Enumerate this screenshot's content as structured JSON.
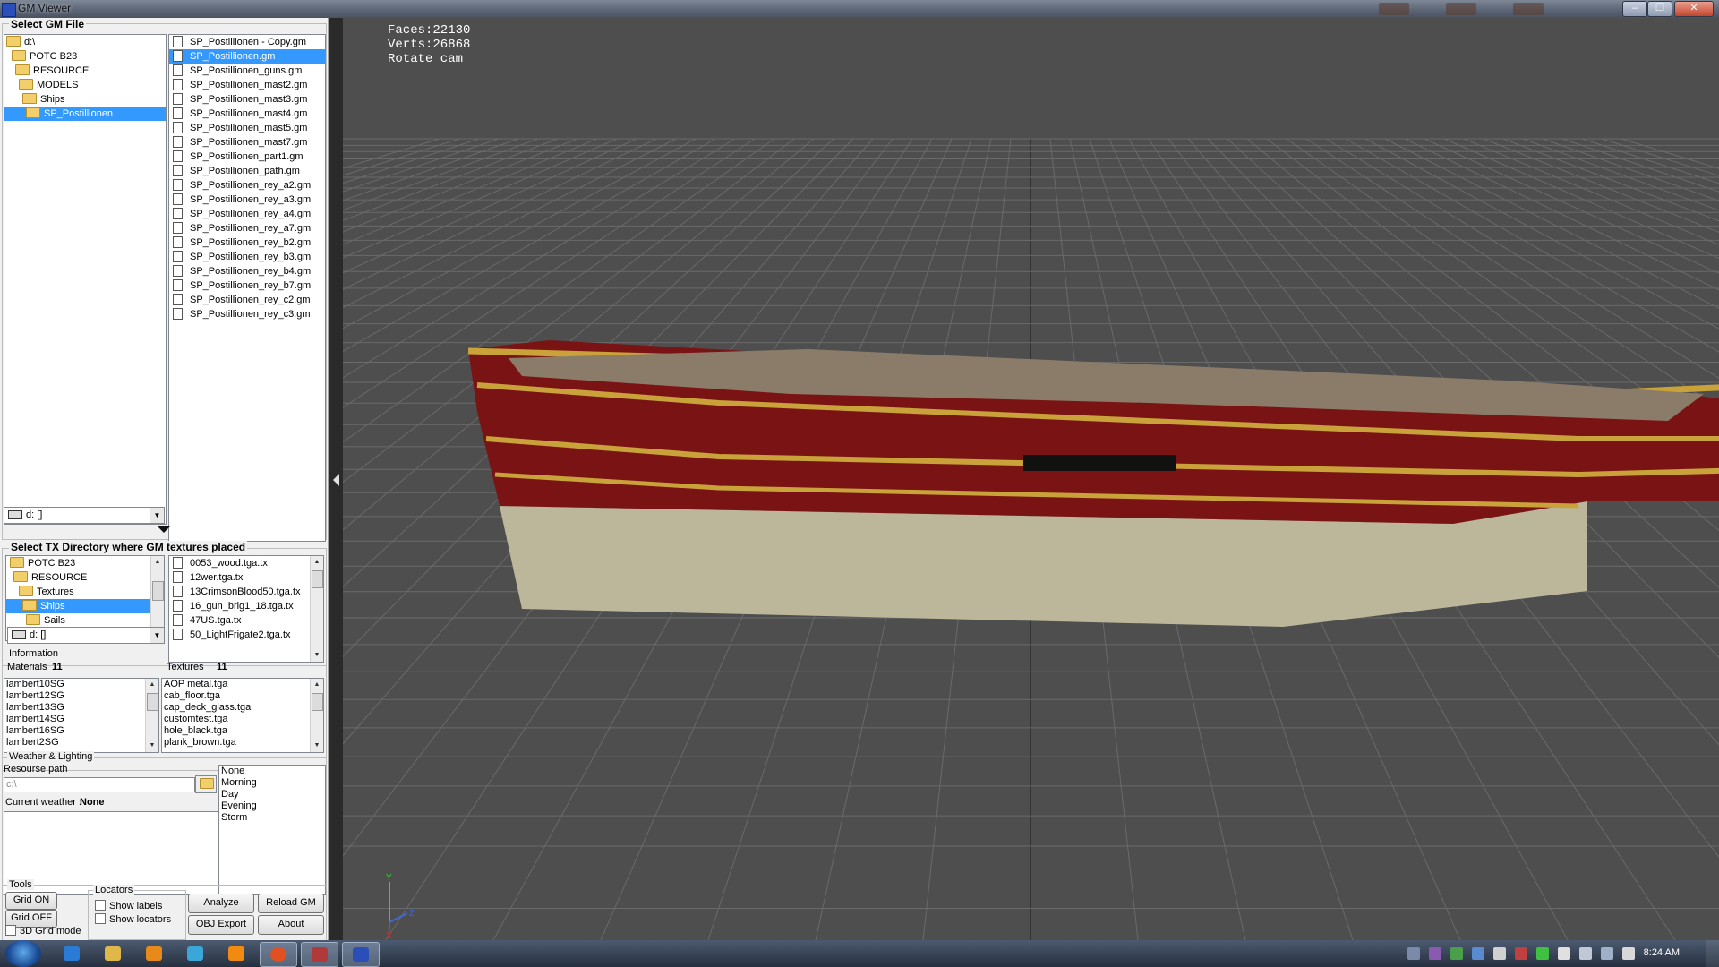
{
  "window": {
    "title": "GM Viewer",
    "buttons": [
      "–",
      "❐",
      "✕"
    ]
  },
  "gm_section": {
    "title": "Select GM File",
    "folders": [
      "d:\\",
      "POTC B23",
      "RESOURCE",
      "MODELS",
      "Ships",
      "SP_Postillionen"
    ],
    "drive": "d: []",
    "files": [
      "SP_Postillionen - Copy.gm",
      "SP_Postillionen.gm",
      "SP_Postillionen_guns.gm",
      "SP_Postillionen_mast2.gm",
      "SP_Postillionen_mast3.gm",
      "SP_Postillionen_mast4.gm",
      "SP_Postillionen_mast5.gm",
      "SP_Postillionen_mast7.gm",
      "SP_Postillionen_part1.gm",
      "SP_Postillionen_path.gm",
      "SP_Postillionen_rey_a2.gm",
      "SP_Postillionen_rey_a3.gm",
      "SP_Postillionen_rey_a4.gm",
      "SP_Postillionen_rey_a7.gm",
      "SP_Postillionen_rey_b2.gm",
      "SP_Postillionen_rey_b3.gm",
      "SP_Postillionen_rey_b4.gm",
      "SP_Postillionen_rey_b7.gm",
      "SP_Postillionen_rey_c2.gm",
      "SP_Postillionen_rey_c3.gm"
    ],
    "selected_file": "SP_Postillionen.gm",
    "selected_folder": "SP_Postillionen"
  },
  "tx_section": {
    "title": "Select TX Directory where GM textures placed",
    "folders": [
      "POTC B23",
      "RESOURCE",
      "Textures",
      "Ships",
      "Sails"
    ],
    "selected_folder": "Ships",
    "drive": "d: []",
    "files": [
      "0053_wood.tga.tx",
      "12wer.tga.tx",
      "13CrimsonBlood50.tga.tx",
      "16_gun_brig1_18.tga.tx",
      "47US.tga.tx",
      "50_LightFrigate2.tga.tx"
    ]
  },
  "information": {
    "title": "Information",
    "materials_label": "Materials",
    "materials_count": "11",
    "textures_label": "Textures",
    "textures_count": "11",
    "materials": [
      "lambert10SG",
      "lambert12SG",
      "lambert13SG",
      "lambert14SG",
      "lambert16SG",
      "lambert2SG"
    ],
    "textures": [
      "AOP metal.tga",
      "cab_floor.tga",
      "cap_deck_glass.tga",
      "customtest.tga",
      "hole_black.tga",
      "plank_brown.tga"
    ]
  },
  "weather": {
    "title": "Weather & Lighting",
    "resource_path_label": "Resourse path",
    "resource_path_value": "c:\\",
    "current_weather_label": "Current weather :",
    "current_weather_value": "None",
    "options": [
      "None",
      "Morning",
      "Day",
      "Evening",
      "Storm"
    ]
  },
  "tools": {
    "title": "Tools",
    "grid_on": "Grid ON",
    "grid_off": "Grid OFF",
    "grid_3d": "3D Grid mode",
    "locators_title": "Locators",
    "show_labels": "Show labels",
    "show_locators": "Show locators",
    "analyze": "Analyze",
    "reload": "Reload GM",
    "obj_export": "OBJ Export",
    "about": "About"
  },
  "viewport": {
    "faces": "Faces:22130",
    "verts": "Verts:26868",
    "mode": "Rotate cam",
    "axis_labels": {
      "y": "Y",
      "z": "Z",
      "x": "X"
    }
  },
  "taskbar": {
    "clock": "8:24 AM"
  },
  "colors": {
    "accent": "#3399ff",
    "viewport_bg": "#4e4e4e",
    "grid_line": "#6a6a6a",
    "hull_red": "#7a1414",
    "hull_trim": "#c9a23a",
    "hull_lower": "#c8c3a4"
  }
}
